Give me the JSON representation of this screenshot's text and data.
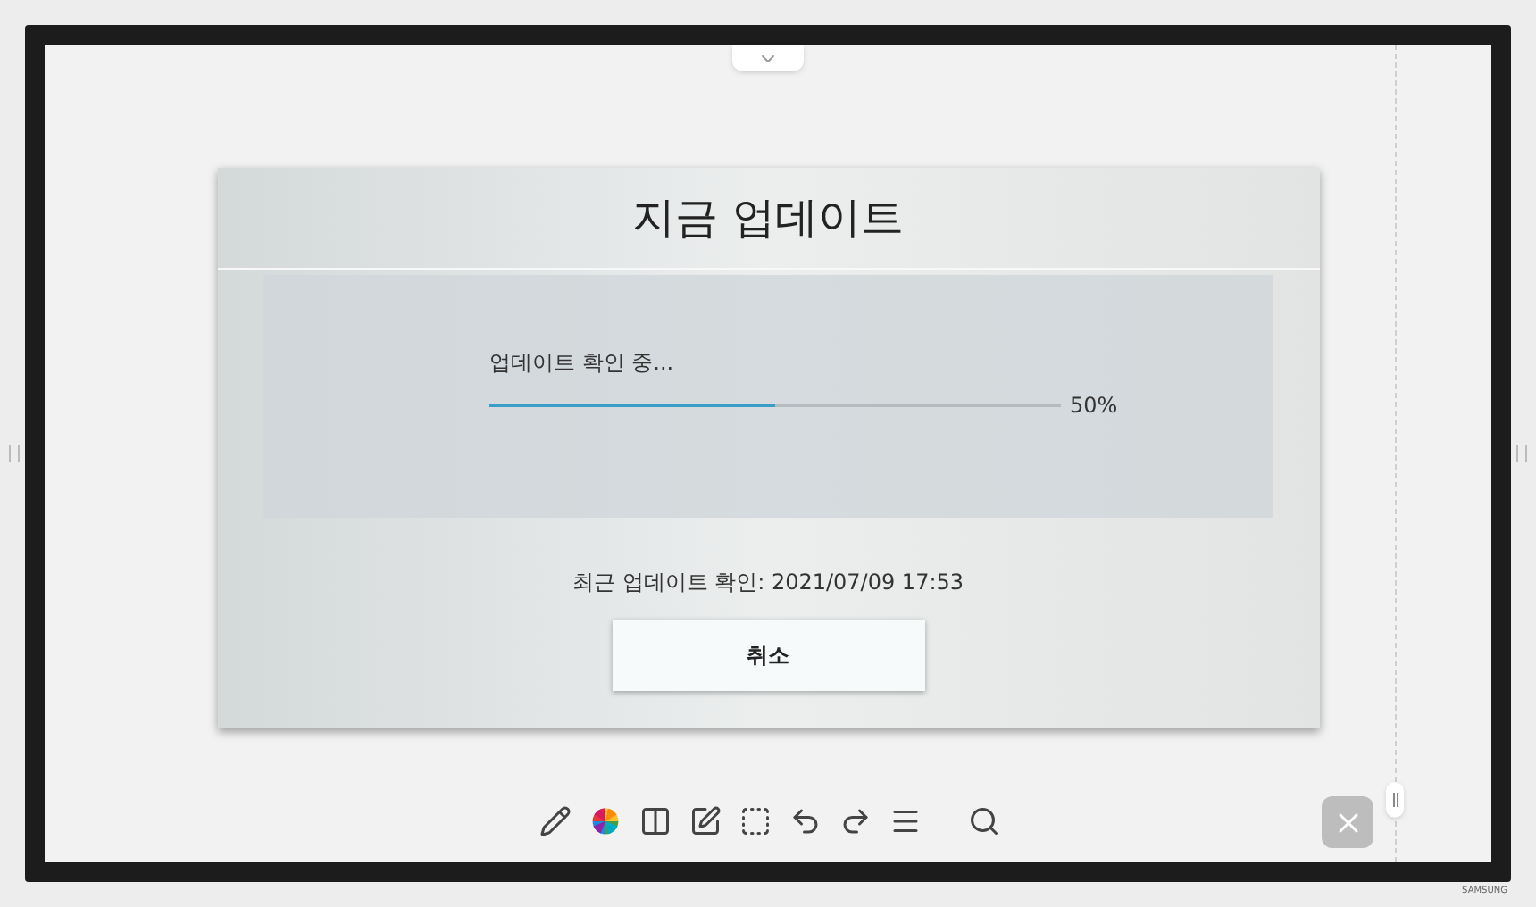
{
  "dialog": {
    "title": "지금 업데이트",
    "progress": {
      "label": "업데이트 확인 중...",
      "level": 0.5,
      "reading": "50%"
    },
    "last_check": "최근 업데이트 확인: 2021/07/09 17:53",
    "buttons": [
      "취소"
    ]
  },
  "brand": "SAMSUNG"
}
